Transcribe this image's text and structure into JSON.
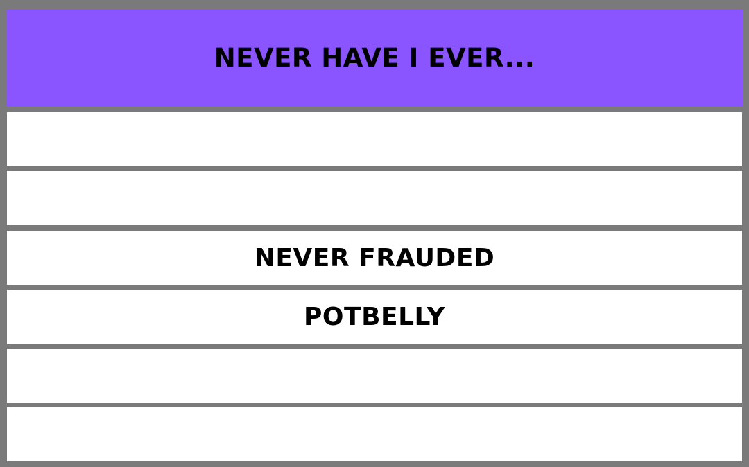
{
  "header": {
    "title": "NEVER HAVE I EVER..."
  },
  "rows": [
    {
      "label": ""
    },
    {
      "label": ""
    },
    {
      "label": "NEVER FRAUDED"
    },
    {
      "label": "POTBELLY"
    },
    {
      "label": ""
    },
    {
      "label": ""
    }
  ],
  "colors": {
    "header_bg": "#8a55ff",
    "frame": "#7a7a7a",
    "row_bg": "#ffffff",
    "text": "#000000"
  }
}
